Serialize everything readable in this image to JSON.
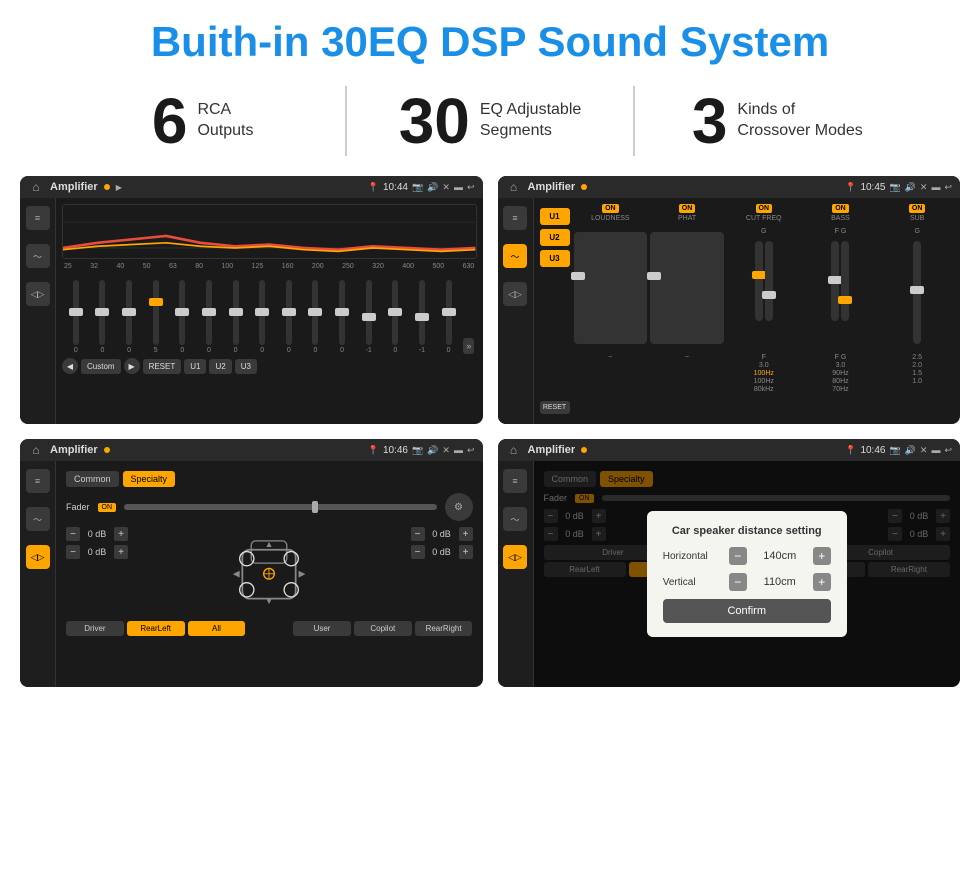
{
  "page": {
    "title": "Buith-in 30EQ DSP Sound System",
    "bg_color": "#ffffff"
  },
  "stats": [
    {
      "number": "6",
      "label": "RCA\nOutputs"
    },
    {
      "number": "30",
      "label": "EQ Adjustable\nSegments"
    },
    {
      "number": "3",
      "label": "Kinds of\nCrossover Modes"
    }
  ],
  "screens": [
    {
      "id": "screen1",
      "topbar": {
        "title": "Amplifier",
        "time": "10:44"
      },
      "type": "eq"
    },
    {
      "id": "screen2",
      "topbar": {
        "title": "Amplifier",
        "time": "10:45"
      },
      "type": "amp2"
    },
    {
      "id": "screen3",
      "topbar": {
        "title": "Amplifier",
        "time": "10:46"
      },
      "type": "speaker"
    },
    {
      "id": "screen4",
      "topbar": {
        "title": "Amplifier",
        "time": "10:46"
      },
      "type": "speaker_dialog"
    }
  ],
  "eq_screen": {
    "frequencies": [
      "25",
      "32",
      "40",
      "50",
      "63",
      "80",
      "100",
      "125",
      "160",
      "200",
      "250",
      "320",
      "400",
      "500",
      "630"
    ],
    "values": [
      "0",
      "0",
      "0",
      "5",
      "0",
      "0",
      "0",
      "0",
      "0",
      "0",
      "0",
      "-1",
      "0",
      "-1",
      "0"
    ],
    "buttons": [
      "Custom",
      "RESET",
      "U1",
      "U2",
      "U3"
    ]
  },
  "amp2_screen": {
    "presets": [
      "U1",
      "U2",
      "U3"
    ],
    "reset_btn": "RESET",
    "channels": [
      {
        "name": "LOUDNESS",
        "on": true
      },
      {
        "name": "PHAT",
        "on": true
      },
      {
        "name": "CUT FREQ",
        "on": true
      },
      {
        "name": "BASS",
        "on": true
      },
      {
        "name": "SUB",
        "on": true
      }
    ]
  },
  "speaker_screen": {
    "tabs": [
      "Common",
      "Specialty"
    ],
    "fader_label": "Fader",
    "fader_on": "ON",
    "db_values": [
      "0 dB",
      "0 dB",
      "0 dB",
      "0 dB"
    ],
    "buttons": [
      "Driver",
      "RearLeft",
      "All",
      "User",
      "Copilot",
      "RearRight"
    ]
  },
  "dialog_screen": {
    "title": "Car speaker distance setting",
    "horizontal_label": "Horizontal",
    "horizontal_value": "140cm",
    "vertical_label": "Vertical",
    "vertical_value": "110cm",
    "confirm_label": "Confirm",
    "tabs": [
      "Common",
      "Specialty"
    ],
    "fader_on": "ON"
  }
}
